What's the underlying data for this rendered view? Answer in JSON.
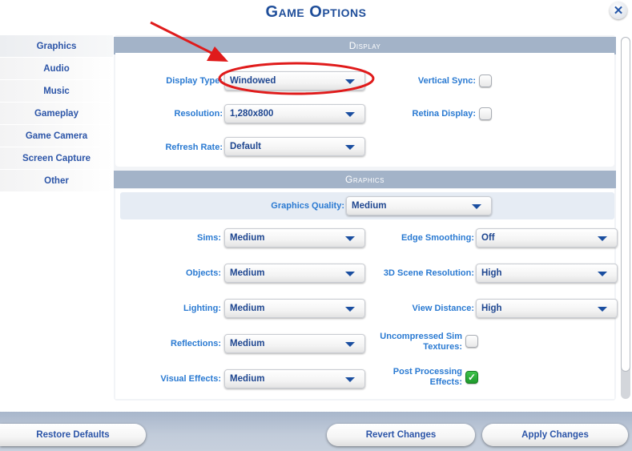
{
  "window": {
    "title": "Game Options",
    "close_icon": "close-icon"
  },
  "sidebar": {
    "items": [
      {
        "label": "Graphics",
        "active": true
      },
      {
        "label": "Audio"
      },
      {
        "label": "Music"
      },
      {
        "label": "Gameplay"
      },
      {
        "label": "Game Camera"
      },
      {
        "label": "Screen Capture"
      },
      {
        "label": "Other"
      }
    ]
  },
  "display": {
    "header": "Display",
    "display_type": {
      "label": "Display Type:",
      "value": "Windowed"
    },
    "resolution": {
      "label": "Resolution:",
      "value": "1,280x800"
    },
    "refresh_rate": {
      "label": "Refresh Rate:",
      "value": "Default"
    },
    "vertical_sync": {
      "label": "Vertical Sync:",
      "checked": false
    },
    "retina_display": {
      "label": "Retina Display:",
      "checked": false
    }
  },
  "graphics": {
    "header": "Graphics",
    "graphics_quality": {
      "label": "Graphics Quality:",
      "value": "Medium"
    },
    "sims": {
      "label": "Sims:",
      "value": "Medium"
    },
    "objects": {
      "label": "Objects:",
      "value": "Medium"
    },
    "lighting": {
      "label": "Lighting:",
      "value": "Medium"
    },
    "reflections": {
      "label": "Reflections:",
      "value": "Medium"
    },
    "visual_effects": {
      "label": "Visual Effects:",
      "value": "Medium"
    },
    "edge_smoothing": {
      "label": "Edge Smoothing:",
      "value": "Off"
    },
    "scene_resolution": {
      "label": "3D Scene Resolution:",
      "value": "High"
    },
    "view_distance": {
      "label": "View Distance:",
      "value": "High"
    },
    "uncompressed_textures": {
      "label_line1": "Uncompressed Sim",
      "label_line2": "Textures:",
      "checked": false
    },
    "post_processing": {
      "label_line1": "Post Processing",
      "label_line2": "Effects:",
      "checked": true,
      "check_glyph": "✓"
    }
  },
  "footer": {
    "restore_defaults": "Restore Defaults",
    "revert_changes": "Revert Changes",
    "apply_changes": "Apply Changes"
  },
  "annotation": {
    "color": "#e01b1b",
    "target": "Display Type dropdown"
  }
}
